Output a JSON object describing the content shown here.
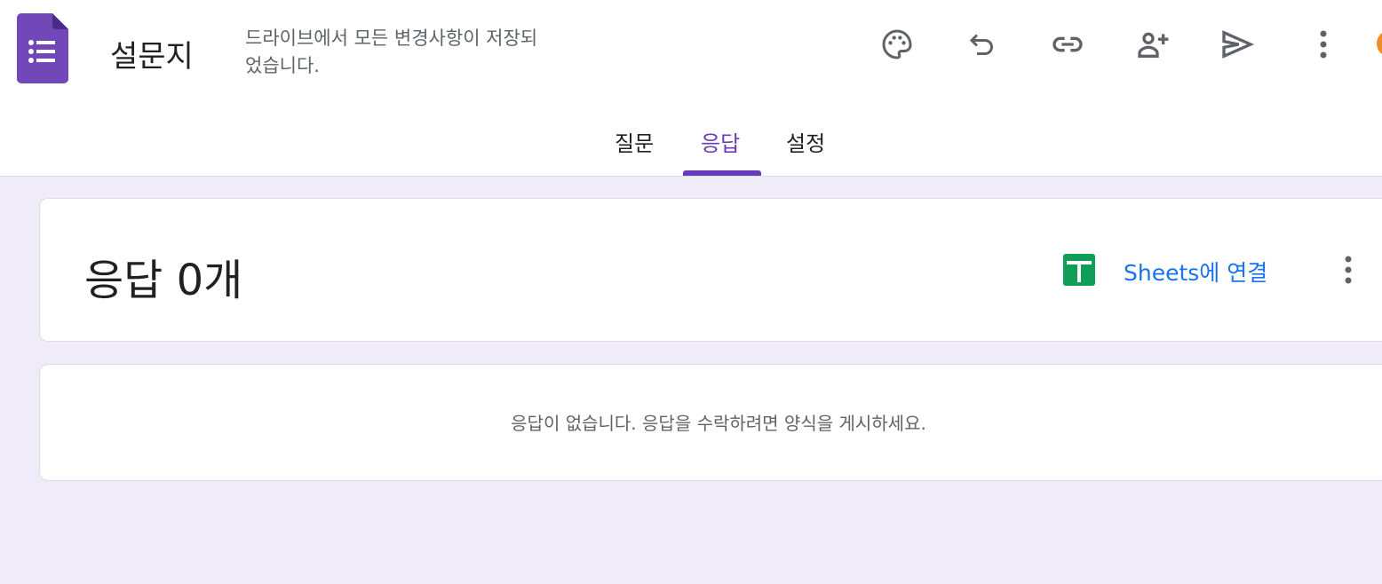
{
  "header": {
    "title": "설문지",
    "save_status": "드라이브에서 모든 변경사항이 저장되었습니다.",
    "icons": [
      "palette-icon",
      "undo-icon",
      "link-icon",
      "add-collaborator-icon",
      "send-icon",
      "more-vert-icon"
    ],
    "accent": "#673ab7"
  },
  "tabs": [
    {
      "label": "질문"
    },
    {
      "label": "응답",
      "active": true
    },
    {
      "label": "설정"
    }
  ],
  "responses": {
    "count_label": "응답 0개",
    "sheets_link": "Sheets에 연결",
    "empty_message": "응답이 없습니다. 응답을 수락하려면 양식을 게시하세요."
  }
}
